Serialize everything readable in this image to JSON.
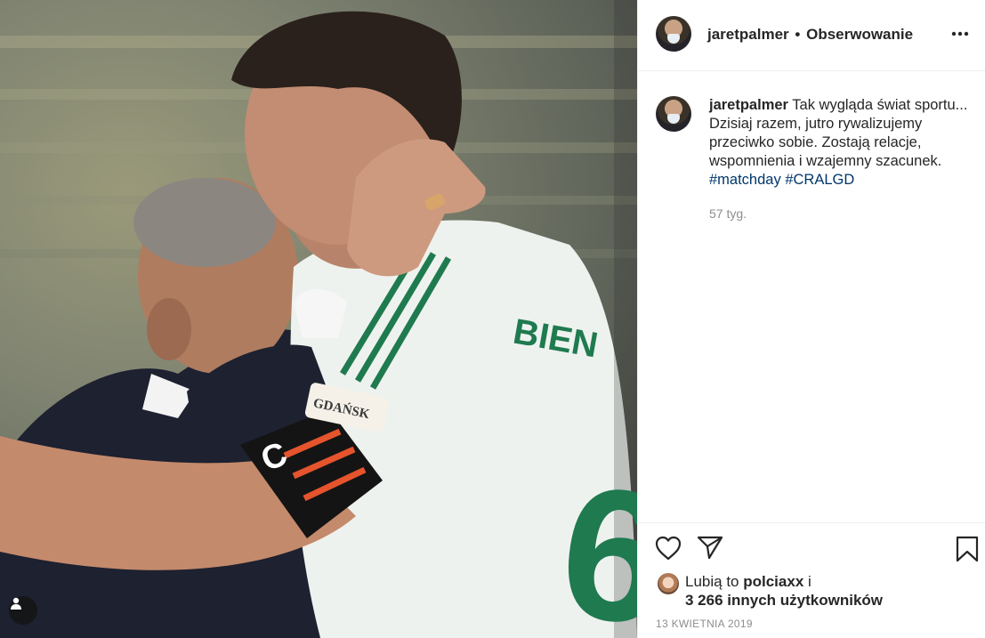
{
  "post": {
    "username": "jaretpalmer",
    "separator": "•",
    "follow_label": "Obserwowanie",
    "more_icon": "more-horizontal-icon",
    "caption_text": "Tak wygląda świat sportu... Dzisiaj razem, jutro rywalizujemy przeciwko sobie. Zostają relacje, wspomnienia i wzajemny szacunek.",
    "hashtags": [
      "#matchday",
      "#CRALGD"
    ],
    "age": "57 tyg.",
    "likes_prefix": "Lubią to",
    "likes_user": "polciaxx",
    "likes_conj": "i",
    "likes_others": "3 266 innych użytkowników",
    "date": "13 KWIETNIA 2019"
  },
  "photo": {
    "jersey_name": "BIEN",
    "jersey_number": "6",
    "badge_text": "GDAŃSK",
    "armband_text": "C"
  },
  "colors": {
    "link": "#00376b",
    "text": "#262626",
    "muted": "#8e8e8e",
    "border": "#efefef",
    "jersey_green": "#1f7a4f"
  }
}
